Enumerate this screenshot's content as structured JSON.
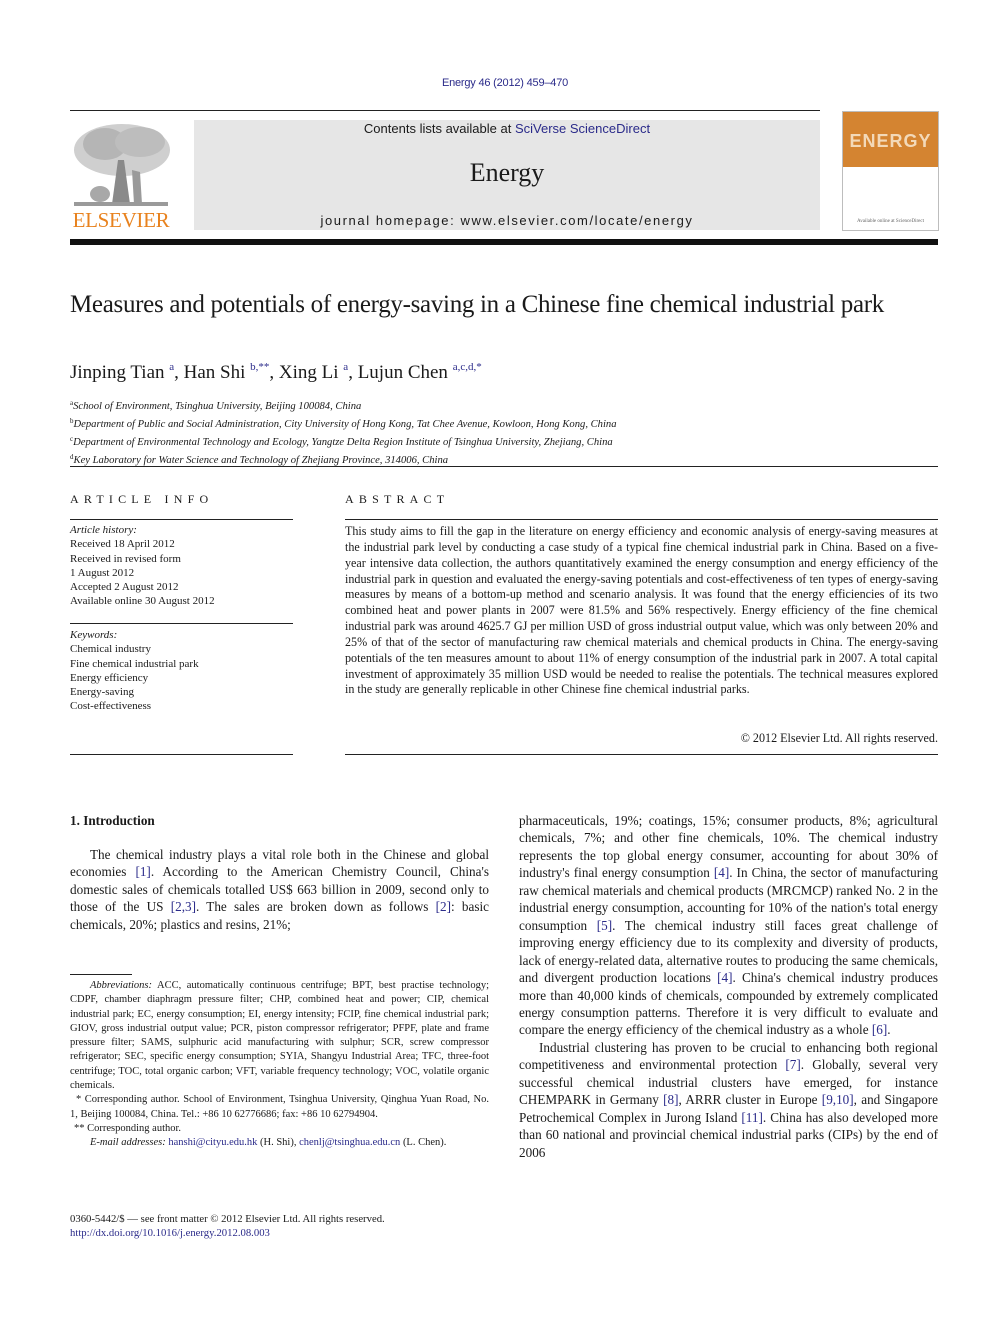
{
  "header": {
    "citation": "Energy 46 (2012) 459–470",
    "contents_prefix": "Contents lists available at ",
    "contents_link": "SciVerse ScienceDirect",
    "journal_name": "Energy",
    "homepage": "journal homepage: www.elsevier.com/locate/energy",
    "publisher_logo_text": "ELSEVIER",
    "cover_title": "ENERGY",
    "cover_footer": "Available online at ScienceDirect",
    "brand_color": "#e8821e",
    "cover_color": "#d48431",
    "link_color": "#2b2b8a"
  },
  "article": {
    "title": "Measures and potentials of energy-saving in a Chinese fine chemical industrial park",
    "authors": [
      {
        "name": "Jinping Tian",
        "marks": "a"
      },
      {
        "name": "Han Shi",
        "marks": "b,**"
      },
      {
        "name": "Xing Li",
        "marks": "a"
      },
      {
        "name": "Lujun Chen",
        "marks": "a,c,d,*"
      }
    ],
    "affiliations": [
      {
        "mark": "a",
        "text": "School of Environment, Tsinghua University, Beijing 100084, China"
      },
      {
        "mark": "b",
        "text": "Department of Public and Social Administration, City University of Hong Kong, Tat Chee Avenue, Kowloon, Hong Kong, China"
      },
      {
        "mark": "c",
        "text": "Department of Environmental Technology and Ecology, Yangtze Delta Region Institute of Tsinghua University, Zhejiang, China"
      },
      {
        "mark": "d",
        "text": "Key Laboratory for Water Science and Technology of Zhejiang Province, 314006, China"
      }
    ]
  },
  "article_info": {
    "heading": "ARTICLE INFO",
    "history_label": "Article history:",
    "history": [
      "Received 18 April 2012",
      "Received in revised form",
      "1 August 2012",
      "Accepted 2 August 2012",
      "Available online 30 August 2012"
    ],
    "keywords_label": "Keywords:",
    "keywords": [
      "Chemical industry",
      "Fine chemical industrial park",
      "Energy efficiency",
      "Energy-saving",
      "Cost-effectiveness"
    ]
  },
  "abstract": {
    "heading": "ABSTRACT",
    "text": "This study aims to fill the gap in the literature on energy efficiency and economic analysis of energy-saving measures at the industrial park level by conducting a case study of a typical fine chemical industrial park in China. Based on a five-year intensive data collection, the authors quantitatively examined the energy consumption and energy efficiency of the industrial park in question and evaluated the energy-saving potentials and cost-effectiveness of ten types of energy-saving measures by means of a bottom-up method and scenario analysis. It was found that the energy efficiencies of its two combined heat and power plants in 2007 were 81.5% and 56% respectively. Energy efficiency of the fine chemical industrial park was around 4625.7 GJ per million USD of gross industrial output value, which was only between 20% and 25% of that of the sector of manufacturing raw chemical materials and chemical products in China. The energy-saving potentials of the ten measures amount to about 11% of energy consumption of the industrial park in 2007. A total capital investment of approximately 35 million USD would be needed to realise the potentials. The technical measures explored in the study are generally replicable in other Chinese fine chemical industrial parks.",
    "copyright": "© 2012 Elsevier Ltd. All rights reserved."
  },
  "introduction": {
    "heading": "1.  Introduction",
    "left": [
      {
        "t": "The chemical industry plays a vital role both in the Chinese and global economies "
      },
      {
        "ref": "[1]"
      },
      {
        "t": ". According to the American Chemistry Council, China's domestic sales of chemicals totalled US$ 663 billion in 2009, second only to those of the US "
      },
      {
        "ref": "[2,3]"
      },
      {
        "t": ". The sales are broken down as follows "
      },
      {
        "ref": "[2]"
      },
      {
        "t": ": basic chemicals, 20%; plastics and resins, 21%;"
      }
    ],
    "right_p1": [
      {
        "t": "pharmaceuticals, 19%; coatings, 15%; consumer products, 8%; agricultural chemicals, 7%; and other fine chemicals, 10%. The chemical industry represents the top global energy consumer, accounting for about 30% of industry's final energy consumption "
      },
      {
        "ref": "[4]"
      },
      {
        "t": ". In China, the sector of manufacturing raw chemical materials and chemical products (MRCMCP) ranked No. 2 in the industrial energy consumption, accounting for 10% of the nation's total energy consumption "
      },
      {
        "ref": "[5]"
      },
      {
        "t": ". The chemical industry still faces great challenge of improving energy efficiency due to its complexity and diversity of products, lack of energy-related data, alternative routes to producing the same chemicals, and divergent production locations "
      },
      {
        "ref": "[4]"
      },
      {
        "t": ". China's chemical industry produces more than 40,000 kinds of chemicals, compounded by extremely complicated energy consumption patterns. Therefore it is very difficult to evaluate and compare the energy efficiency of the chemical industry as a whole "
      },
      {
        "ref": "[6]"
      },
      {
        "t": "."
      }
    ],
    "right_p2": [
      {
        "t": "Industrial clustering has proven to be crucial to enhancing both regional competitiveness and environmental protection "
      },
      {
        "ref": "[7]"
      },
      {
        "t": ". Globally, several very successful chemical industrial clusters have emerged, for instance CHEMPARK in Germany "
      },
      {
        "ref": "[8]"
      },
      {
        "t": ", ARRR cluster in Europe "
      },
      {
        "ref": "[9,10]"
      },
      {
        "t": ", and Singapore Petrochemical Complex in Jurong Island "
      },
      {
        "ref": "[11]"
      },
      {
        "t": ". China has also developed more than 60 national and provincial chemical industrial parks (CIPs) by the end of 2006"
      }
    ]
  },
  "footnotes": {
    "abbreviations_label": "Abbreviations:",
    "abbreviations": "ACC, automatically continuous centrifuge; BPT, best practise technology; CDPF, chamber diaphragm pressure filter; CHP, combined heat and power; CIP, chemical industrial park; EC, energy consumption; EI, energy intensity; FCIP, fine chemical industrial park; GIOV, gross industrial output value; PCR, piston compressor refrigerator; PFPF, plate and frame pressure filter; SAMS, sulphuric acid manufacturing with sulphur; SCR, screw compressor refrigerator; SEC, specific energy consumption; SYIA, Shangyu Industrial Area; TFC, three-foot centrifuge; TOC, total organic carbon; VFT, variable frequency technology; VOC, volatile organic chemicals.",
    "corr1": "* Corresponding author. School of Environment, Tsinghua University, Qinghua Yuan Road, No. 1, Beijing 100084, China. Tel.: +86 10 62776686; fax: +86 10 62794904.",
    "corr2": "** Corresponding author.",
    "email_label": "E-mail addresses:",
    "email1": "hanshi@cityu.edu.hk",
    "email1_who": " (H. Shi), ",
    "email2": "chenlj@tsinghua.edu.cn",
    "email2_who": " (L. Chen)."
  },
  "bottom": {
    "issn": "0360-5442/$ — see front matter © 2012 Elsevier Ltd. All rights reserved.",
    "doi": "http://dx.doi.org/10.1016/j.energy.2012.08.003"
  }
}
